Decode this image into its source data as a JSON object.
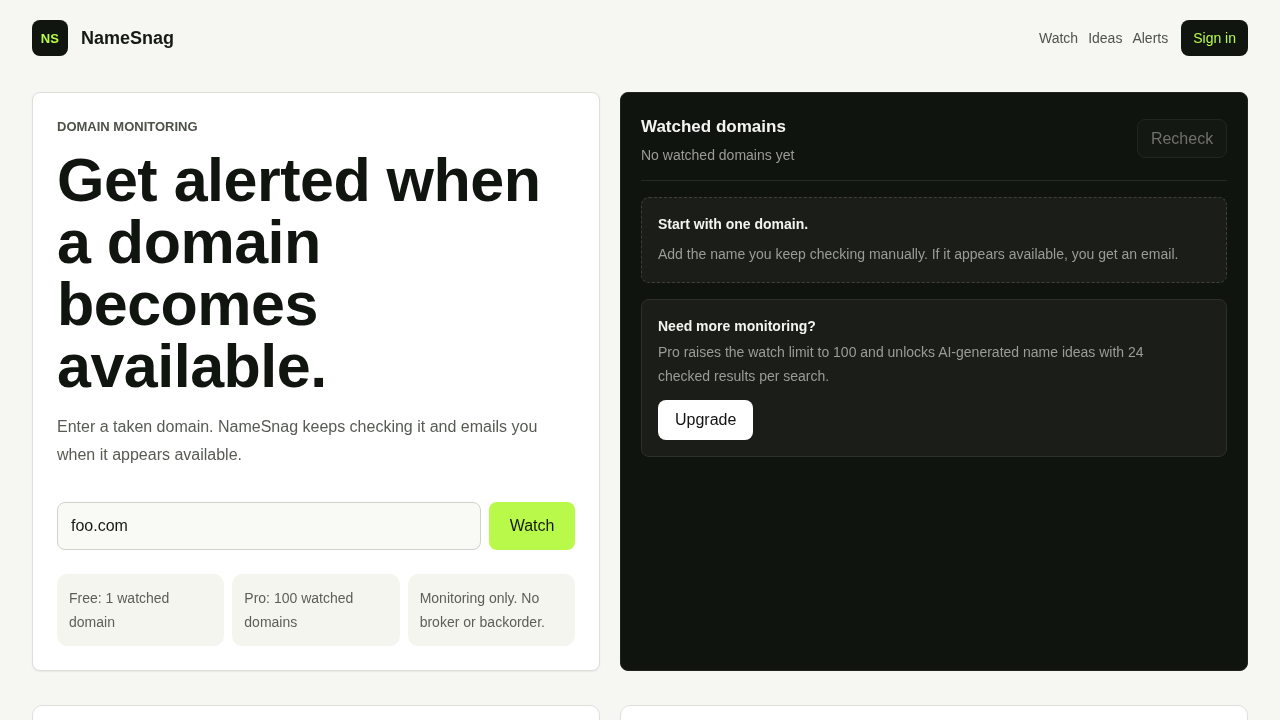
{
  "header": {
    "logo": {
      "mark": "NS",
      "name": "NameSnag"
    },
    "nav": [
      {
        "label": "Watch"
      },
      {
        "label": "Ideas"
      },
      {
        "label": "Alerts"
      }
    ],
    "sign_in": "Sign in"
  },
  "hero": {
    "eyebrow": "DOMAIN MONITORING",
    "headline": "Get alerted when a domain becomes available.",
    "description": "Enter a taken domain. NameSnag keeps checking it and emails you when it appears available.",
    "domain_input": {
      "value": "foo.com"
    },
    "watch_button": "Watch",
    "facts": [
      "Free: 1 watched domain",
      "Pro: 100 watched domains",
      "Monitoring only. No broker or backorder."
    ]
  },
  "watchlist": {
    "title": "Watched domains",
    "subtitle": "No watched domains yet",
    "recheck_button": {
      "label": "Recheck",
      "disabled": true
    },
    "notices": [
      {
        "kind": "empty",
        "title": "Start with one domain.",
        "text": "Add the name you keep checking manually. If it appears available, you get an email."
      },
      {
        "kind": "upsell",
        "title": "Need more monitoring?",
        "text": "Pro raises the watch limit to 100 and unlocks AI-generated name ideas with 24 checked results per search.",
        "button": "Upgrade"
      }
    ]
  }
}
